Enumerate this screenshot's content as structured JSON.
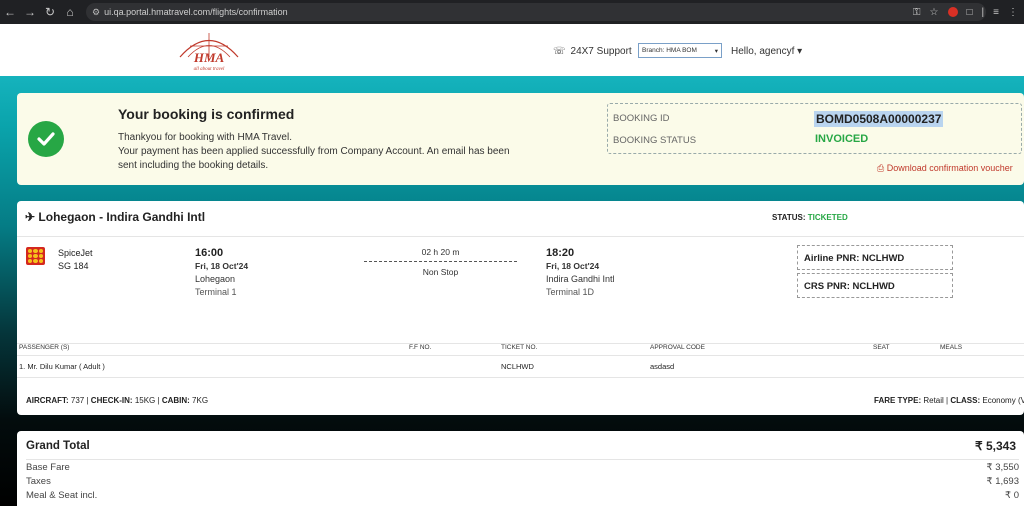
{
  "browser": {
    "url": "ui.qa.portal.hmatravel.com/flights/confirmation"
  },
  "header": {
    "logo_text": "HMA",
    "logo_tagline": "all about travel",
    "support_label": "24X7 Support",
    "branch_select_value": "Branch: HMA BOM",
    "user_greeting": "Hello, agencyf"
  },
  "confirmation": {
    "title": "Your booking is confirmed",
    "message_line1": "Thankyou for booking with HMA Travel.",
    "message_line2": "Your payment has been applied successfully from Company Account. An email has been sent including the booking details.",
    "booking_id_label": "BOOKING ID",
    "booking_id": "BOMD0508A00000237",
    "booking_status_label": "BOOKING STATUS",
    "booking_status": "INVOICED",
    "download_label": "Download confirmation voucher",
    "colors": {
      "success": "#27a745",
      "link": "#c0392b"
    }
  },
  "flight": {
    "route": "Lohegaon - Indira Gandhi Intl",
    "status_label": "STATUS:",
    "status_value": "TICKETED",
    "airline": "SpiceJet",
    "flight_no": "SG 184",
    "departure": {
      "time": "16:00",
      "date": "Fri, 18 Oct'24",
      "airport": "Lohegaon",
      "terminal": "Terminal 1"
    },
    "arrival": {
      "time": "18:20",
      "date": "Fri, 18 Oct'24",
      "airport": "Indira Gandhi Intl",
      "terminal": "Terminal 1D"
    },
    "duration": "02 h 20 m",
    "stops": "Non Stop",
    "airline_pnr": "Airline PNR: NCLHWD",
    "crs_pnr": "CRS PNR: NCLHWD"
  },
  "passengers": {
    "headers": [
      "PASSENGER (S)",
      "F.F NO.",
      "TICKET NO.",
      "APPROVAL CODE",
      "SEAT",
      "MEALS"
    ],
    "rows": [
      {
        "name": "1. Mr. Dilu Kumar ( Adult )",
        "ff": "",
        "ticket": "NCLHWD",
        "approval": "asdasd",
        "seat": "",
        "meals": ""
      }
    ]
  },
  "details": {
    "aircraft_label": "AIRCRAFT:",
    "aircraft_value": "737 |",
    "checkin_label": "CHECK-IN:",
    "checkin_value": "15KG |",
    "cabin_label": "CABIN:",
    "cabin_value": "7KG",
    "fare_type_label": "FARE TYPE:",
    "fare_type_value": "Retail |",
    "class_label": "CLASS:",
    "class_value": "Economy (V"
  },
  "pricing": {
    "grand_total_label": "Grand Total",
    "grand_total": "₹ 5,343",
    "rows": [
      {
        "label": "Base Fare",
        "value": "₹ 3,550"
      },
      {
        "label": "Taxes",
        "value": "₹ 1,693"
      },
      {
        "label": "Meal & Seat incl.",
        "value": "₹ 0"
      }
    ]
  }
}
